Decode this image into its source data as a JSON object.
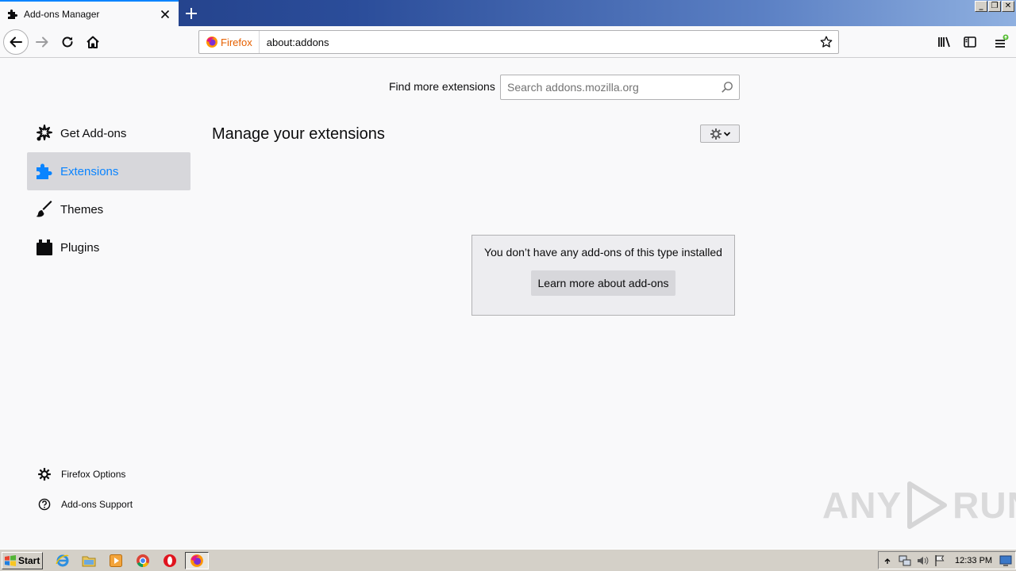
{
  "tab": {
    "title": "Add-ons Manager"
  },
  "navbar": {
    "identity_label": "Firefox",
    "url": "about:addons"
  },
  "search": {
    "label": "Find more extensions",
    "placeholder": "Search addons.mozilla.org"
  },
  "sidebar": {
    "items": [
      {
        "label": "Get Add-ons",
        "icon": "get-addons-icon"
      },
      {
        "label": "Extensions",
        "icon": "puzzle-icon",
        "selected": true
      },
      {
        "label": "Themes",
        "icon": "brush-icon"
      },
      {
        "label": "Plugins",
        "icon": "plugin-icon"
      }
    ],
    "footer": [
      {
        "label": "Firefox Options",
        "icon": "gear-icon"
      },
      {
        "label": "Add-ons Support",
        "icon": "help-icon"
      }
    ]
  },
  "main": {
    "heading": "Manage your extensions",
    "empty_message": "You don’t have any add-ons of this type installed",
    "learn_more_label": "Learn more about add-ons"
  },
  "watermark": {
    "left": "ANY",
    "right": "RUN"
  },
  "taskbar": {
    "start_label": "Start",
    "clock": "12:33 PM",
    "apps": [
      "ie-icon",
      "folder-icon",
      "media-player-icon",
      "chrome-icon",
      "opera-icon",
      "firefox-icon"
    ]
  },
  "colors": {
    "accent": "#0a84ff",
    "selected_bg": "#d7d7db",
    "firefox_orange": "#e66000"
  }
}
